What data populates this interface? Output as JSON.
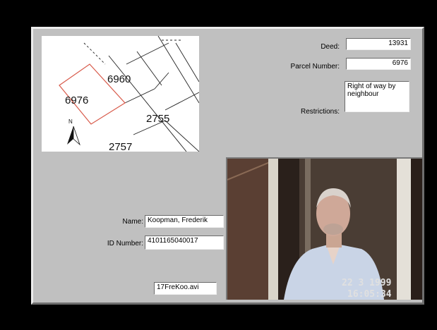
{
  "map": {
    "parcels": [
      "6960",
      "6976",
      "2755",
      "2757"
    ],
    "north_label": "N"
  },
  "deed": {
    "label": "Deed:",
    "value": "13931"
  },
  "parcel_number": {
    "label": "Parcel Number:",
    "value": "6976"
  },
  "restrictions": {
    "label": "Restrictions:",
    "value": "Right of way by neighbour"
  },
  "name": {
    "label": "Name:",
    "value": "Koopman, Frederik"
  },
  "id_number": {
    "label": "ID Number:",
    "value": "4101165040017"
  },
  "video_file": {
    "value": "17FreKoo.avi"
  },
  "photo": {
    "date_stamp": "22 3 1999",
    "time_stamp": "16:05:34"
  },
  "colors": {
    "panel_bg": "#c0c0c0",
    "parcel_highlight": "#d85a4a",
    "page_bg": "#000000"
  }
}
